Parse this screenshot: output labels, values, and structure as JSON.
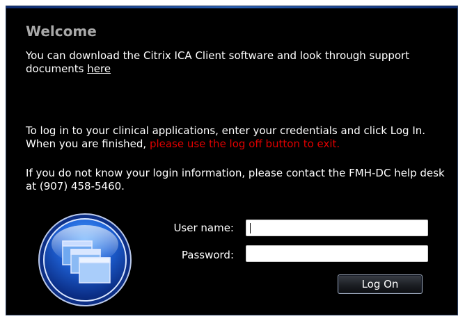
{
  "welcome": {
    "title": "Welcome",
    "download_text_before": "You can download the Citrix ICA Client software and look through support documents ",
    "download_link_label": "here"
  },
  "instructions": {
    "login_text": "To log in to your clinical applications, enter your credentials and click Log In. When you are finished, ",
    "login_warning": "please use the log off button to exit.",
    "help_text": "If you do not know your login information, please contact the FMH-DC help desk at (907) 458-5460."
  },
  "form": {
    "username_label": "User name:",
    "username_value": "",
    "password_label": "Password:",
    "password_value": "",
    "logon_button_label": "Log On"
  },
  "colors": {
    "background": "#000000",
    "title": "#a9a9a9",
    "warning": "#e00000",
    "accent": "#1f63d8"
  },
  "icons": {
    "logo": "citrix-windows-orb-icon"
  }
}
